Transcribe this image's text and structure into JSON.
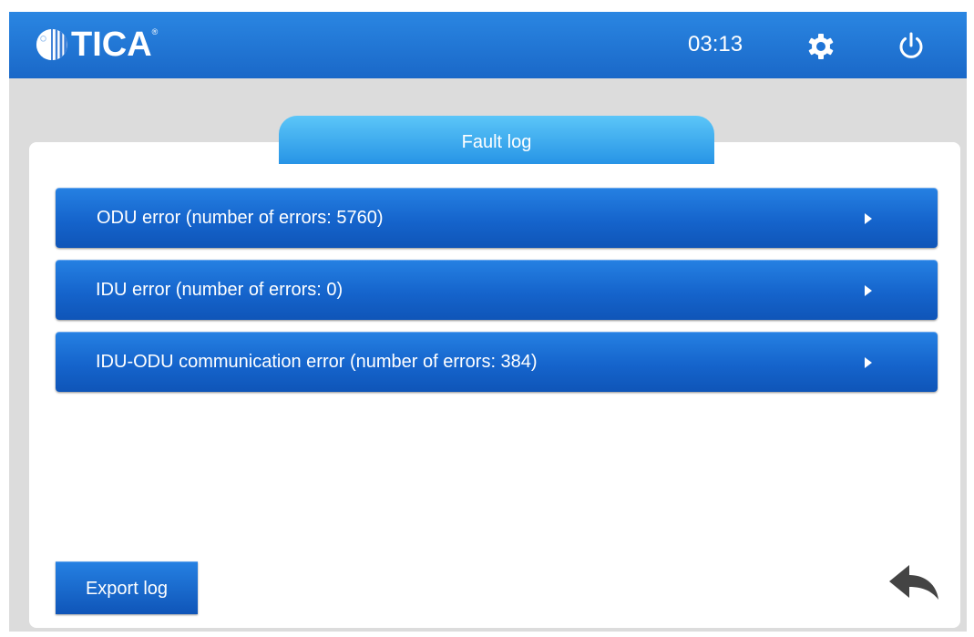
{
  "header": {
    "logo_text": "TICA",
    "logo_reg": "®",
    "time": "03:13",
    "icons": {
      "settings": "gear-icon",
      "power": "power-icon"
    }
  },
  "tab": {
    "label": "Fault log"
  },
  "errors": [
    {
      "label": "ODU error (number of errors: 5760)"
    },
    {
      "label": "IDU error (number of errors: 0)"
    },
    {
      "label": "IDU-ODU communication error (number of errors: 384)"
    }
  ],
  "footer": {
    "export_label": "Export log",
    "back_icon": "back-arrow-icon"
  },
  "colors": {
    "header_blue": "#1a68c8",
    "tab_light_blue": "#5cc6f8",
    "button_blue": "#1564cc",
    "background_gray": "#dcdcdc",
    "back_icon_gray": "#444444"
  }
}
